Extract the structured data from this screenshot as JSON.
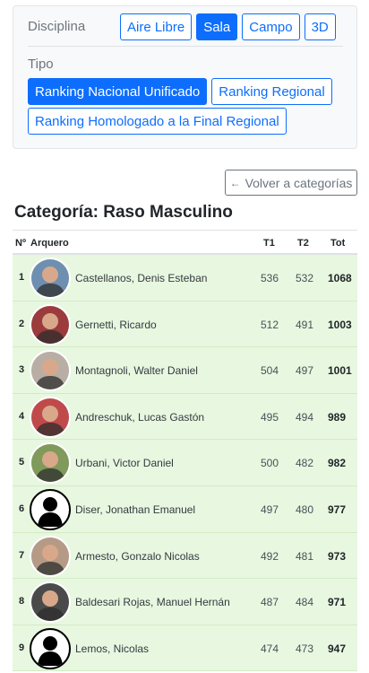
{
  "filters": {
    "disciplina_label": "Disciplina",
    "disciplinas": [
      "Aire Libre",
      "Sala",
      "Campo",
      "3D"
    ],
    "disciplina_active": "Sala",
    "tipo_label": "Tipo",
    "tipos": [
      "Ranking Nacional Unificado",
      "Ranking Regional",
      "Ranking Homologado a la Final Regional"
    ],
    "tipo_active": "Ranking Nacional Unificado"
  },
  "back_button": {
    "arrow": "←",
    "label": "Volver a categorías"
  },
  "category": {
    "prefix": "Categoría:",
    "name": "Raso Masculino"
  },
  "table": {
    "headers": {
      "pos": "Nº",
      "archer": "Arquero",
      "t1": "T1",
      "t2": "T2",
      "tot": "Tot"
    },
    "rows": [
      {
        "pos": "1",
        "name": "Castellanos, Denis Esteban",
        "t1": "536",
        "t2": "532",
        "tot": "1068",
        "photo": "photo",
        "tone": "#6f8fb0"
      },
      {
        "pos": "2",
        "name": "Gernetti, Ricardo",
        "t1": "512",
        "t2": "491",
        "tot": "1003",
        "photo": "photo",
        "tone": "#9b3b3b"
      },
      {
        "pos": "3",
        "name": "Montagnoli, Walter Daniel",
        "t1": "504",
        "t2": "497",
        "tot": "1001",
        "photo": "photo",
        "tone": "#b8aea4"
      },
      {
        "pos": "4",
        "name": "Andreschuk, Lucas Gastón",
        "t1": "495",
        "t2": "494",
        "tot": "989",
        "photo": "photo",
        "tone": "#c04a4a"
      },
      {
        "pos": "5",
        "name": "Urbani, Victor Daniel",
        "t1": "500",
        "t2": "482",
        "tot": "982",
        "photo": "photo",
        "tone": "#7f9a5a"
      },
      {
        "pos": "6",
        "name": "Diser, Jonathan Emanuel",
        "t1": "497",
        "t2": "480",
        "tot": "977",
        "photo": "placeholder",
        "tone": "#000000"
      },
      {
        "pos": "7",
        "name": "Armesto, Gonzalo Nicolas",
        "t1": "492",
        "t2": "481",
        "tot": "973",
        "photo": "photo",
        "tone": "#b59a86"
      },
      {
        "pos": "8",
        "name": "Baldesari Rojas, Manuel Hernán",
        "t1": "487",
        "t2": "484",
        "tot": "971",
        "photo": "photo",
        "tone": "#4a4a4a"
      },
      {
        "pos": "9",
        "name": "Lemos, Nicolas",
        "t1": "474",
        "t2": "473",
        "tot": "947",
        "photo": "placeholder",
        "tone": "#000000"
      }
    ]
  },
  "colors": {
    "primary": "#0d6efd",
    "row_bg": "#e8f7e0",
    "secondary": "#6c757d"
  }
}
